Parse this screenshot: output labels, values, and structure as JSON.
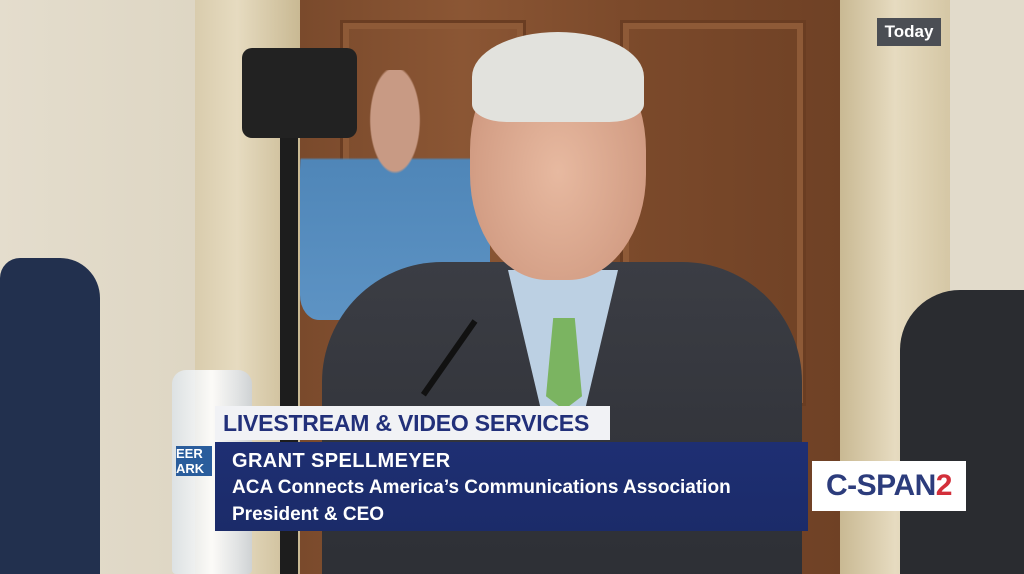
{
  "badge": {
    "label": "Today"
  },
  "banner": {
    "title": "LIVESTREAM & VIDEO SERVICES"
  },
  "lower_third": {
    "name": "GRANT SPELLMEYER",
    "organization": "ACA Connects America’s Communications Association",
    "role": "President & CEO"
  },
  "logo": {
    "brand": "C-SPAN",
    "number": "2"
  },
  "colors": {
    "banner_text": "#22307a",
    "lower_third_bg": "#1e2f73",
    "logo_number": "#d32f3a"
  },
  "video_scene": {
    "bottle_label_fragment": [
      "EER",
      "ARK"
    ]
  }
}
